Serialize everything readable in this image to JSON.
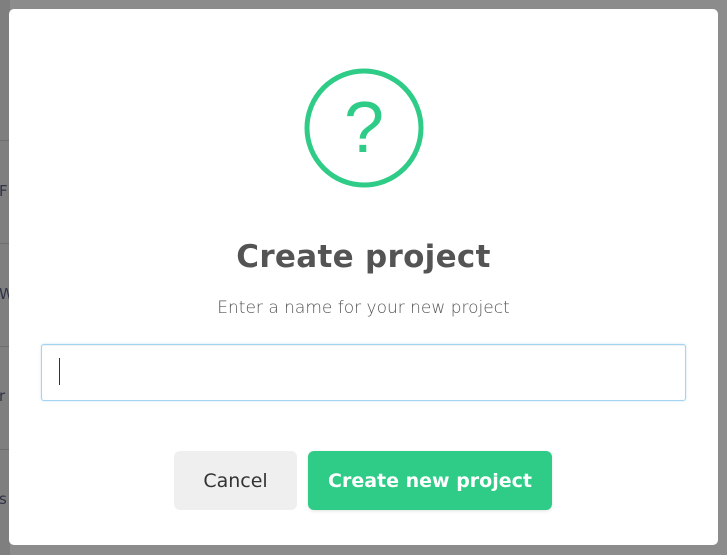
{
  "modal": {
    "title": "Create project",
    "subtitle": "Enter a name for your new project",
    "icon": "question-icon",
    "icon_glyph": "?",
    "input": {
      "value": "",
      "placeholder": ""
    },
    "buttons": {
      "cancel_label": "Cancel",
      "create_label": "Create new project"
    }
  },
  "colors": {
    "accent": "#2ecc87",
    "icon_ring": "#2ecc87",
    "title_text": "#545454",
    "cancel_bg": "#efefef",
    "input_border": "#a3d4f2",
    "overlay": "#8c8c8c"
  },
  "background": {
    "row_letters": [
      "F",
      "W",
      "r",
      "s"
    ]
  }
}
